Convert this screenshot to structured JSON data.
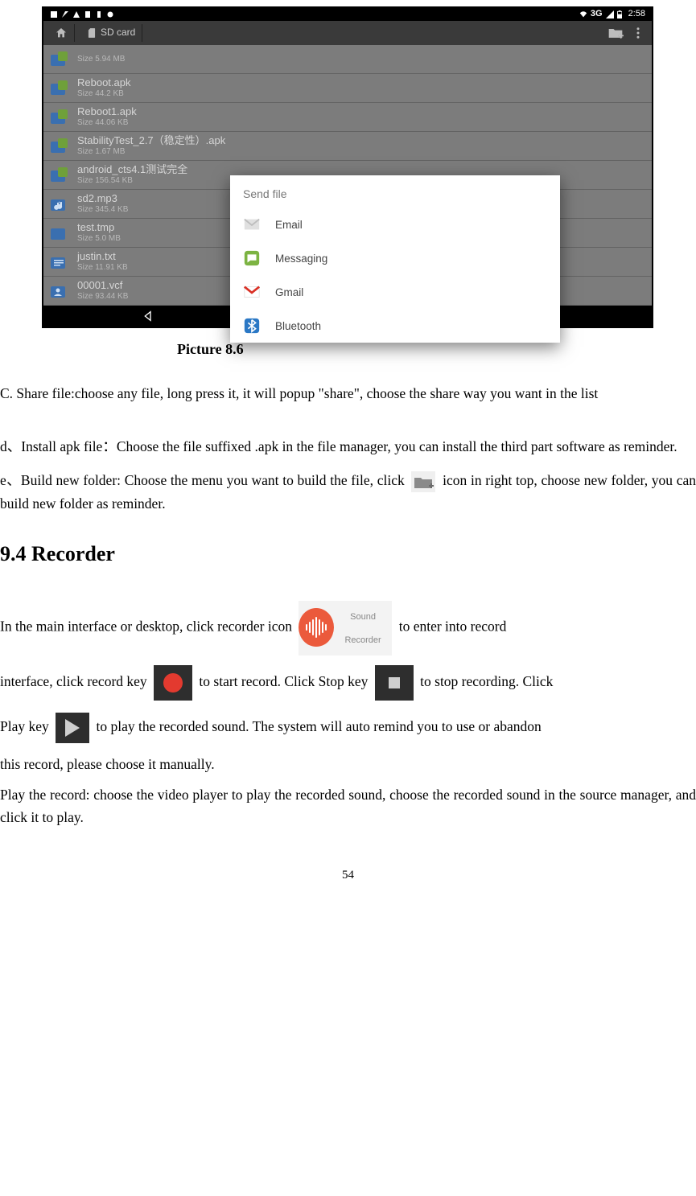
{
  "screenshot": {
    "statusbar": {
      "network": "3G",
      "clock": "2:58"
    },
    "toolbar": {
      "breadcrumb_sd": "SD card"
    },
    "files": [
      {
        "name": "",
        "size": "Size 5.94 MB"
      },
      {
        "name": "Reboot.apk",
        "size": "Size 44.2 KB"
      },
      {
        "name": "Reboot1.apk",
        "size": "Size 44.06 KB"
      },
      {
        "name": "StabilityTest_2.7（稳定性）.apk",
        "size": "Size 1.67 MB"
      },
      {
        "name": "android_cts4.1测试完全",
        "size": "Size 156.54 KB"
      },
      {
        "name": "sd2.mp3",
        "size": "Size 345.4 KB"
      },
      {
        "name": "test.tmp",
        "size": "Size 5.0 MB"
      },
      {
        "name": "justin.txt",
        "size": "Size 11.91 KB"
      },
      {
        "name": "00001.vcf",
        "size": "Size 93.44 KB"
      }
    ],
    "dialog": {
      "title": "Send file",
      "items": [
        {
          "label": "Email"
        },
        {
          "label": "Messaging"
        },
        {
          "label": "Gmail"
        },
        {
          "label": "Bluetooth"
        }
      ]
    }
  },
  "doc": {
    "caption": "Picture 8.6",
    "para_c": "C. Share file:choose any file, long press it, it will popup \"share\", choose the share way you want in the list",
    "para_d": "d、Install apk file：Choose the file suffixed .apk in the file manager, you can install the third part software as reminder.",
    "para_e_pre": "e、Build new folder: Choose the menu you want to build the file, click ",
    "para_e_post": " icon in right top, choose new folder, you can build new folder as reminder.",
    "heading": "9.4 Recorder",
    "rec_1_pre": "In the main interface or desktop, click recorder icon ",
    "rec_1_post": " to enter into record ",
    "rec_2_pre": "interface, click record key ",
    "rec_2_mid1": " to start record. Click Stop key ",
    "rec_2_mid2": " to stop recording. Click ",
    "rec_3_pre": "Play key ",
    "rec_3_post": " to play the recorded sound. The system will auto remind you to use or abandon ",
    "rec_4": "this record, please choose it manually.",
    "rec_5": "Play the record: choose the video player to play the recorded sound, choose the recorded sound in the source manager, and click it to play.",
    "sound_recorder_label": "Sound Recorder",
    "page_number": "54"
  }
}
